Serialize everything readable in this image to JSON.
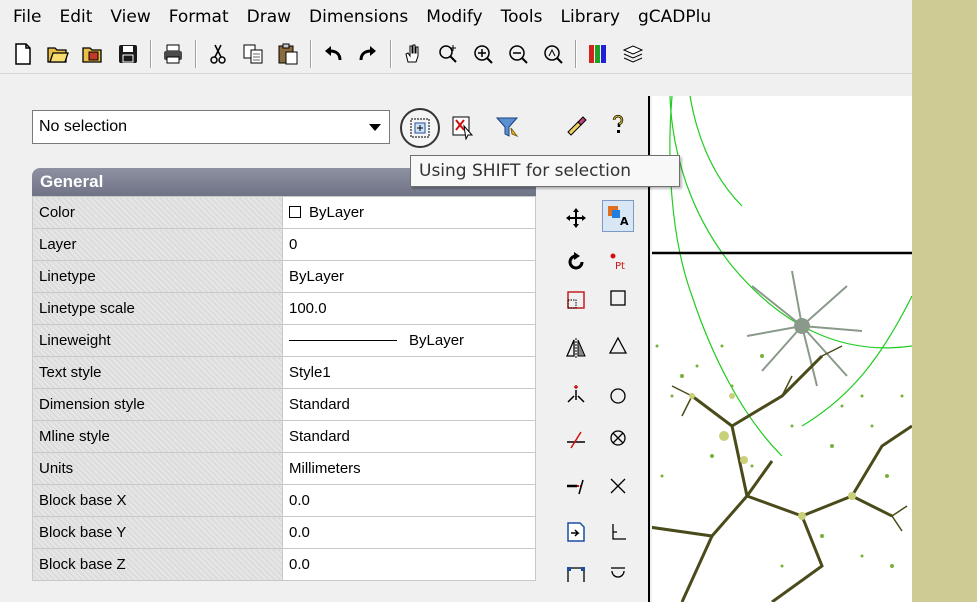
{
  "menu": [
    "File",
    "Edit",
    "View",
    "Format",
    "Draw",
    "Dimensions",
    "Modify",
    "Tools",
    "Library",
    "gCADPlu"
  ],
  "toolbar": {
    "icons": [
      "new-file-icon",
      "open-folder-icon",
      "open-template-icon",
      "save-icon",
      "print-icon",
      "cut-icon",
      "copy-icon",
      "paste-icon",
      "undo-icon",
      "redo-icon",
      "pan-hand-icon",
      "zoom-realtime-icon",
      "zoom-in-icon",
      "zoom-out-icon",
      "zoom-window-icon",
      "color-bars-icon",
      "layers-icon"
    ]
  },
  "properties": {
    "selection_value": "No selection",
    "tooltip": "Using SHIFT for selection",
    "section_title": "General",
    "rows": [
      {
        "key": "Color",
        "value": "ByLayer"
      },
      {
        "key": "Layer",
        "value": "0"
      },
      {
        "key": "Linetype",
        "value": "ByLayer"
      },
      {
        "key": "Linetype scale",
        "value": "100.0"
      },
      {
        "key": "Lineweight",
        "value": "ByLayer"
      },
      {
        "key": "Text style",
        "value": "Style1"
      },
      {
        "key": "Dimension style",
        "value": "Standard"
      },
      {
        "key": "Mline style",
        "value": "Standard"
      },
      {
        "key": "Units",
        "value": "Millimeters"
      },
      {
        "key": "Block base X",
        "value": "0.0"
      },
      {
        "key": "Block base Y",
        "value": "0.0"
      },
      {
        "key": "Block base Z",
        "value": "0.0"
      }
    ]
  },
  "modify_toolbar": {
    "icons": [
      "match-properties-icon",
      "help-icon",
      "move-icon",
      "text-style-icon",
      "rotate-icon",
      "point-icon",
      "scale-icon",
      "rectangle-icon",
      "mirror-icon",
      "triangle-icon",
      "break-icon",
      "circle-icon",
      "trim-icon",
      "circle-x-icon",
      "extend-icon",
      "cross-icon",
      "insert-block-icon",
      "angle-dimension-icon",
      "rect-corners-icon",
      "arc-icon"
    ],
    "point_label": "Pt",
    "text_style_label": "A"
  },
  "colors": {
    "panel_header": "#7a7e90",
    "canvas_green": "#22cc22",
    "olive_strip": "#cfcb94"
  }
}
